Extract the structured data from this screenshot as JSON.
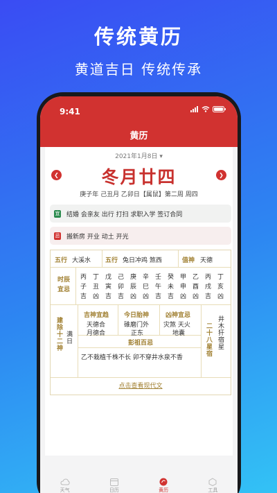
{
  "promo": {
    "title": "传统黄历",
    "subtitle": "黄道吉日  传统传承"
  },
  "status": {
    "time": "9:41"
  },
  "app": {
    "title": "黄历"
  },
  "date": {
    "selected": "2021年1月8日",
    "lunar": "冬月廿四",
    "ganzhi": "庚子年 己丑月 乙卯日【属鼠】第二周 周四"
  },
  "yi": {
    "badge": "宜",
    "items": "结婚 会亲友 出行 打扫 求职入学 签订合同"
  },
  "ji": {
    "badge": "忌",
    "items": "搬新房 开业 动土 开光"
  },
  "grid": {
    "wuxing_label": "五行",
    "wuxing_value": "大溪水",
    "wuxing2_label": "五行",
    "wuxing2_value": "兔日冲鸡 煞西",
    "zhishen_label": "值神",
    "zhishen_value": "天德",
    "shichen_label": "时辰宜忌",
    "shichen": [
      [
        "丙",
        "子",
        "吉"
      ],
      [
        "丁",
        "丑",
        "凶"
      ],
      [
        "戊",
        "寅",
        "吉"
      ],
      [
        "己",
        "卯",
        "吉"
      ],
      [
        "庚",
        "辰",
        "凶"
      ],
      [
        "辛",
        "巳",
        "凶"
      ],
      [
        "壬",
        "午",
        "吉"
      ],
      [
        "癸",
        "未",
        "吉"
      ],
      [
        "甲",
        "申",
        "凶"
      ],
      [
        "乙",
        "酉",
        "凶"
      ],
      [
        "丙",
        "戌",
        "吉"
      ],
      [
        "丁",
        "亥",
        "凶"
      ]
    ],
    "jianchu_label": "建除十二神",
    "jianchu_value": "满日",
    "jishen_label": "吉神宜趋",
    "jishen_value1": "天德合",
    "jishen_value2": "月德合",
    "taishen_label": "今日胎神",
    "taishen_value1": "碓磨门外",
    "taishen_value2": "正东",
    "xiongshen_label": "凶神宜忌",
    "xiongshen_value1": "灾煞 天火",
    "xiongshen_value2": "地囊",
    "xingxiu_label": "二十八星宿",
    "xingxiu_value": "井木犴宿星",
    "pengzu_label": "彭祖百忌",
    "pengzu_value": "乙不栽植千株不长 卯不穿井水泉不香",
    "link": "点击查看现代文"
  },
  "tabs": [
    {
      "label": "天气",
      "icon": "cloud-icon"
    },
    {
      "label": "日历",
      "icon": "calendar-icon"
    },
    {
      "label": "黄历",
      "icon": "almanac-icon"
    },
    {
      "label": "工具",
      "icon": "tools-icon"
    }
  ],
  "colors": {
    "accent": "#d13230",
    "gold": "#a07f30"
  }
}
